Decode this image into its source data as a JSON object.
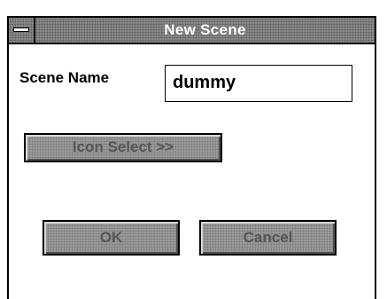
{
  "dialog": {
    "title": "New Scene",
    "scene_name_label": "Scene Name",
    "scene_name_value": "dummy",
    "icon_select_label": "Icon Select >>",
    "ok_label": "OK",
    "cancel_label": "Cancel"
  },
  "colors": {
    "titlebar": "#8c8c8c",
    "button_face": "#9d9d9d",
    "background": "#ffffff"
  },
  "icons": {
    "system_menu": "system-menu-icon"
  }
}
